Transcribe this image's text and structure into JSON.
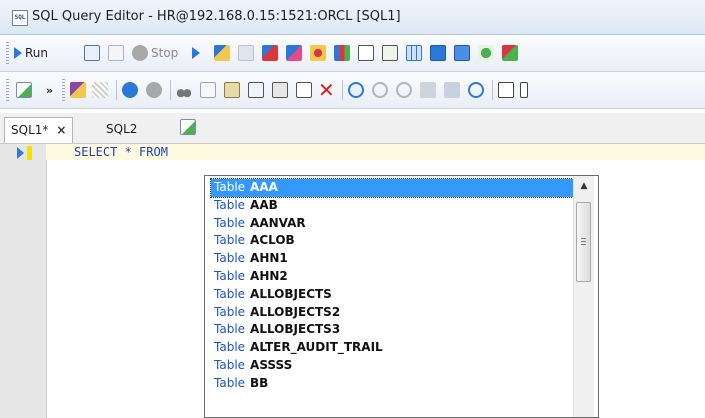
{
  "window": {
    "title": "SQL Query Editor - HR@192.168.0.15:1521:ORCL [SQL1]",
    "app_icon_text": "SQL"
  },
  "toolbar1": {
    "run_label": "Run",
    "stop_label": "Stop"
  },
  "tabs": [
    {
      "label": "SQL1*",
      "close": "×"
    },
    {
      "label": "SQL2"
    }
  ],
  "editor": {
    "line1": "SELECT * FROM"
  },
  "autocomplete": {
    "items": [
      {
        "kind": "Table",
        "name": "AAA",
        "selected": true
      },
      {
        "kind": "Table",
        "name": "AAB"
      },
      {
        "kind": "Table",
        "name": "AANVAR"
      },
      {
        "kind": "Table",
        "name": "ACLOB"
      },
      {
        "kind": "Table",
        "name": "AHN1"
      },
      {
        "kind": "Table",
        "name": "AHN2"
      },
      {
        "kind": "Table",
        "name": "ALLOBJECTS"
      },
      {
        "kind": "Table",
        "name": "ALLOBJECTS2"
      },
      {
        "kind": "Table",
        "name": "ALLOBJECTS3"
      },
      {
        "kind": "Table",
        "name": "ALTER_AUDIT_TRAIL"
      },
      {
        "kind": "Table",
        "name": "ASSSS"
      },
      {
        "kind": "Table",
        "name": "BB"
      }
    ],
    "scroll_up": "▲"
  }
}
